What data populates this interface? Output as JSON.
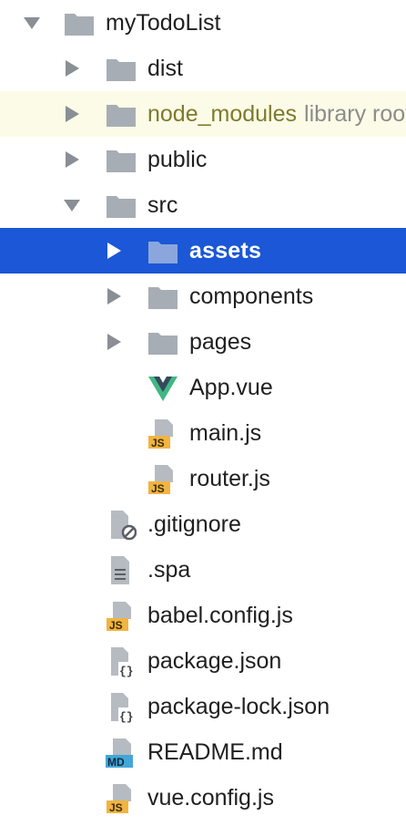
{
  "tree": {
    "root": {
      "label": "myTodoList",
      "expanded": true
    },
    "dist": {
      "label": "dist"
    },
    "node_modules": {
      "label": "node_modules",
      "hint": "library root"
    },
    "public": {
      "label": "public"
    },
    "src": {
      "label": "src",
      "expanded": true
    },
    "assets": {
      "label": "assets",
      "selected": true
    },
    "components": {
      "label": "components"
    },
    "pages": {
      "label": "pages"
    },
    "app_vue": {
      "label": "App.vue"
    },
    "main_js": {
      "label": "main.js",
      "badge": "JS"
    },
    "router_js": {
      "label": "router.js",
      "badge": "JS"
    },
    "gitignore": {
      "label": ".gitignore"
    },
    "spa": {
      "label": ".spa"
    },
    "babel_config": {
      "label": "babel.config.js",
      "badge": "JS"
    },
    "package_json": {
      "label": "package.json"
    },
    "package_lock": {
      "label": "package-lock.json"
    },
    "readme": {
      "label": "README.md",
      "badge": "MD"
    },
    "vue_config": {
      "label": "vue.config.js",
      "badge": "JS"
    }
  },
  "colors": {
    "selection": "#1b57d6",
    "library_row": "#fbfbe7",
    "folder": "#a7adb4",
    "js_badge": "#f1b441",
    "md_badge": "#43a6d8"
  }
}
